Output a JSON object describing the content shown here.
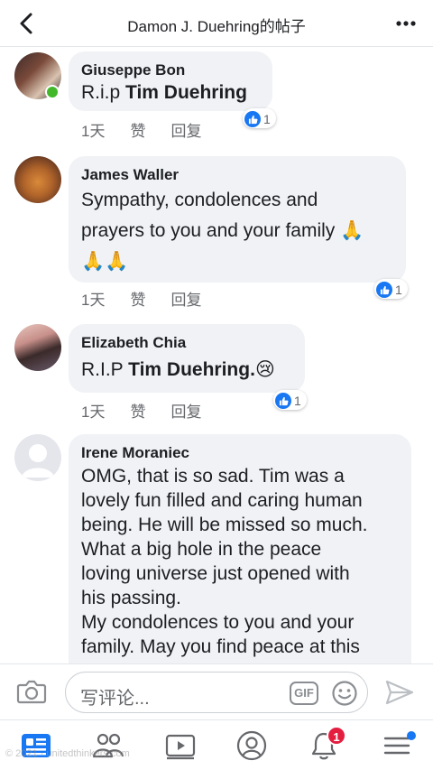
{
  "header": {
    "title": "Damon J. Duehring的帖子",
    "back_icon": "chevron-left-icon",
    "more_icon": "more-dots-icon"
  },
  "comments": [
    {
      "author": "Giuseppe Bon",
      "text_plain": "R.i.p ",
      "text_bold": "Tim Duehring",
      "time": "1天",
      "like": "赞",
      "reply": "回复",
      "reactions": "1",
      "online": true
    },
    {
      "author": "James Waller",
      "text_line1": "Sympathy, condolences and",
      "text_line2": "prayers to you and your family 🙏",
      "text_line3": "🙏🙏",
      "time": "1天",
      "like": "赞",
      "reply": "回复",
      "reactions": "1"
    },
    {
      "author": "Elizabeth Chia",
      "text_plain": "R.I.P ",
      "text_bold": "Tim Duehring.",
      "text_emoji": "😢",
      "time": "1天",
      "like": "赞",
      "reply": "回复",
      "reactions": "1"
    },
    {
      "author": "Irene Moraniec",
      "lines": [
        "OMG, that is so sad. Tim was a",
        "lovely fun filled and caring human",
        "being. He will be missed so much.",
        "What a big hole in the peace",
        "loving universe just opened with",
        "his passing.",
        "My condolences to you and your",
        "family. May you find peace at this"
      ]
    }
  ],
  "composer": {
    "placeholder": "写评论...",
    "gif_label": "GIF"
  },
  "tabbar": {
    "notification_count": "1"
  },
  "watermark": "© 2021 · unitedthinkers.com",
  "colors": {
    "brand_blue": "#1877f2",
    "bubble_gray": "#f0f2f5",
    "online_green": "#42b72a",
    "badge_red": "#e41e3f"
  }
}
